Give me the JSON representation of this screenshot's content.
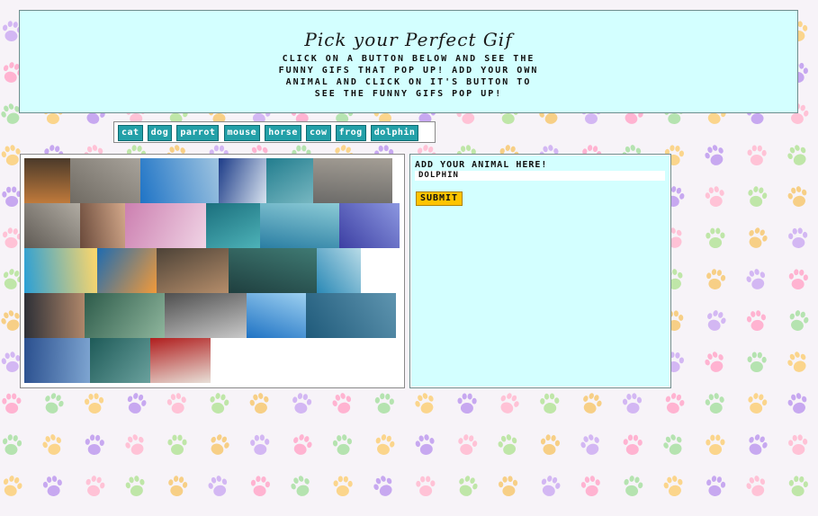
{
  "header": {
    "title": "Pick your Perfect Gif",
    "subtitle": "Click on a button below and see the funny gifs that pop up! Add your own animal and click on it's button to see the funny gifs pop up!"
  },
  "buttons": [
    "cat",
    "dog",
    "parrot",
    "mouse",
    "horse",
    "cow",
    "frog",
    "dolphin"
  ],
  "form": {
    "label": "Add your animal here!",
    "input_value": "dolphin",
    "submit_label": "Submit"
  },
  "gifs": [
    {
      "name": "gif-cat-dolphin-1",
      "colors": [
        "#c07a3b",
        "#4b3a2a"
      ]
    },
    {
      "name": "gif-cat-dolphin-2",
      "colors": [
        "#6f6a62",
        "#a8a39b"
      ]
    },
    {
      "name": "gif-dolphin-smile",
      "colors": [
        "#1f74c6",
        "#9fc4e0"
      ]
    },
    {
      "name": "gif-dolphin-jump",
      "colors": [
        "#1d3c88",
        "#d8e3ef"
      ]
    },
    {
      "name": "gif-dolphin-surf",
      "colors": [
        "#227d8e",
        "#77b7c1"
      ]
    },
    {
      "name": "gif-dolphin-person",
      "colors": [
        "#6b6a68",
        "#a49e95"
      ]
    },
    {
      "name": "gif-hand-dolphin",
      "colors": [
        "#5f5a54",
        "#b1aca3"
      ]
    },
    {
      "name": "gif-tv-dolphin",
      "colors": [
        "#6a4a3b",
        "#d3a88a"
      ]
    },
    {
      "name": "gif-cartoon-dolphin",
      "colors": [
        "#cc7fb0",
        "#f0d4e5"
      ]
    },
    {
      "name": "gif-dolphin-underwater",
      "colors": [
        "#1b6f7d",
        "#4db2b8"
      ]
    },
    {
      "name": "gif-dolphin-pod",
      "colors": [
        "#2a7ea3",
        "#8ccbd6"
      ]
    },
    {
      "name": "gif-dolphin-castle",
      "colors": [
        "#3c3fa3",
        "#8c97e0"
      ]
    },
    {
      "name": "gif-just-chill",
      "colors": [
        "#2a9fd6",
        "#ffd76a"
      ]
    },
    {
      "name": "gif-dolphin-cartoon-surf",
      "colors": [
        "#1e6bb0",
        "#f29a3a"
      ]
    },
    {
      "name": "gif-cat-dolphin-3",
      "colors": [
        "#4c4237",
        "#b58d6a"
      ]
    },
    {
      "name": "gif-dolphin-closeup",
      "colors": [
        "#1f3f3f",
        "#3f7a73"
      ]
    },
    {
      "name": "gif-dolphin-boat",
      "colors": [
        "#2a89b6",
        "#b8dbe7"
      ]
    },
    {
      "name": "gif-dolphin-trainer",
      "colors": [
        "#2c2f36",
        "#b0876a"
      ]
    },
    {
      "name": "gif-dolphin-splash",
      "colors": [
        "#2d5b4a",
        "#8fb69d"
      ]
    },
    {
      "name": "gif-dolphins-leap",
      "colors": [
        "#4f4f4f",
        "#c9c9c9"
      ]
    },
    {
      "name": "gif-white-dolphin",
      "colors": [
        "#1f73c4",
        "#9dd0f0"
      ]
    },
    {
      "name": "gif-dolphin-ocean",
      "colors": [
        "#1f5a7a",
        "#5f95b0"
      ]
    },
    {
      "name": "gif-dolphin-sea",
      "colors": [
        "#2a4f8e",
        "#7ea5d1"
      ]
    },
    {
      "name": "gif-dolphin-show",
      "colors": [
        "#1e5a58",
        "#6aa19d"
      ]
    },
    {
      "name": "gif-cartoon-dolphin-podium",
      "colors": [
        "#b01e1e",
        "#e8e0d8"
      ]
    }
  ]
}
